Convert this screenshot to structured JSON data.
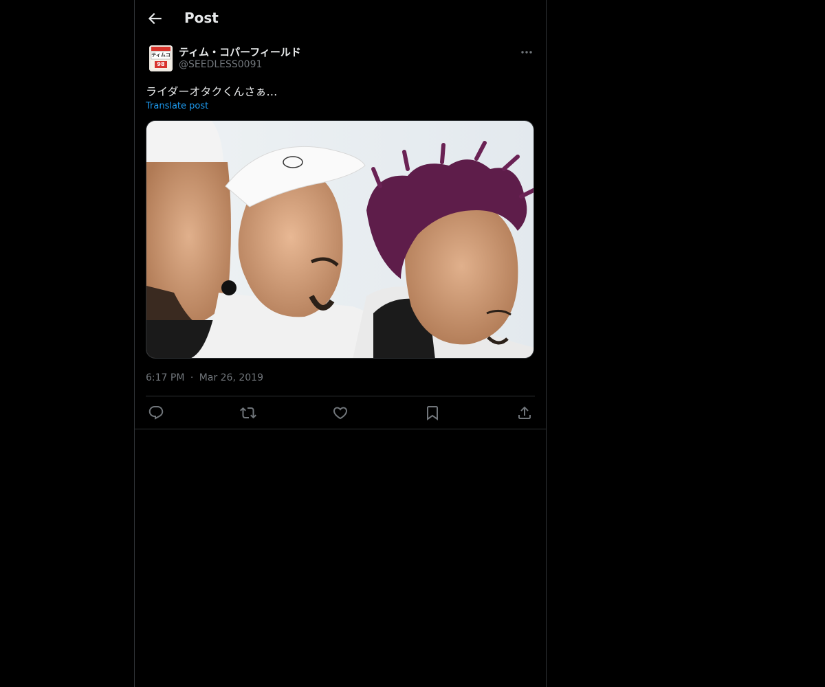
{
  "header": {
    "title": "Post",
    "back_icon": "arrow-left-icon"
  },
  "post": {
    "author": {
      "display_name": "ティム・コパーフィールド",
      "handle": "@SEEDLESS0091",
      "avatar_text": "ティムコ",
      "avatar_number": "98"
    },
    "text": "ライダーオタクくんさぁ…",
    "translate_label": "Translate post",
    "time": "6:17 PM",
    "date_separator": "·",
    "date": "Mar 26, 2019"
  },
  "actions": [
    {
      "icon": "reply-icon"
    },
    {
      "icon": "repost-icon"
    },
    {
      "icon": "like-icon"
    },
    {
      "icon": "bookmark-icon"
    },
    {
      "icon": "share-icon"
    }
  ],
  "colors": {
    "background": "#000000",
    "text_primary": "#e7e9ea",
    "text_secondary": "#71767b",
    "accent": "#1d9bf0",
    "border": "#2f3336"
  }
}
